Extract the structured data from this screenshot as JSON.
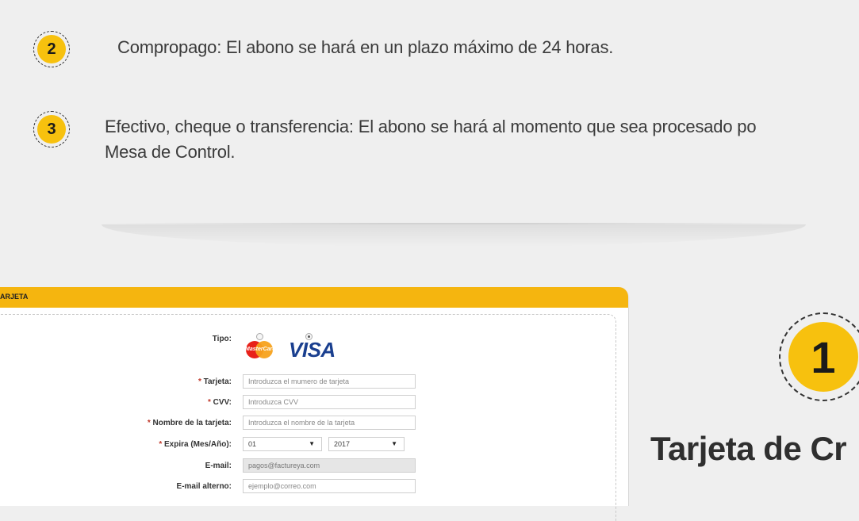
{
  "steps": [
    {
      "number": "2",
      "text_line1": "Compropago: El abono se hará en un plazo máximo de 24 horas.",
      "text_line2": ""
    },
    {
      "number": "3",
      "text_line1": "Efectivo, cheque o transferencia: El abono se hará al momento que sea procesado po",
      "text_line2": "Mesa de Control."
    }
  ],
  "panel": {
    "header": "ARJETA",
    "tipo_label": "Tipo:",
    "brands": [
      "MasterCard",
      "VISA"
    ],
    "selected_brand": "VISA",
    "fields": [
      {
        "label": "Tarjeta:",
        "required": true,
        "placeholder": "Introduzca el mumero de tarjeta",
        "value": ""
      },
      {
        "label": "CVV:",
        "required": true,
        "placeholder": "Introduzca CVV",
        "value": ""
      },
      {
        "label": "Nombre de la tarjeta:",
        "required": true,
        "placeholder": "Introduzca el nombre de la tarjeta",
        "value": ""
      }
    ],
    "expira_label": "Expira (Mes/Año):",
    "expira_required": true,
    "month_value": "01",
    "year_value": "2017",
    "email_label": "E-mail:",
    "email_value": "pagos@factureya.com",
    "email_alt_label": "E-mail alterno:",
    "email_alt_placeholder": "ejemplo@correo.com"
  },
  "feature": {
    "number": "1",
    "title": "Tarjeta  de Cr"
  },
  "colors": {
    "accent": "#f7c10e",
    "header": "#f5b50f",
    "background": "#efefef"
  }
}
